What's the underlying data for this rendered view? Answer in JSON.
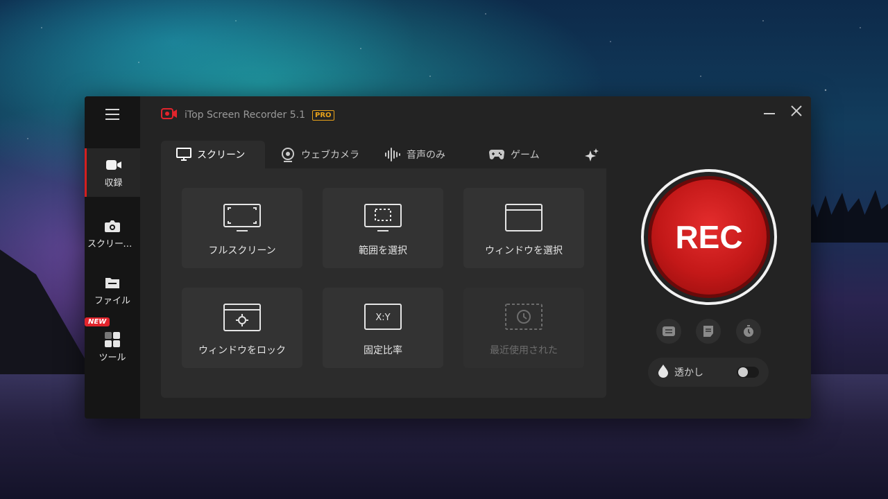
{
  "app": {
    "title": "iTop Screen Recorder 5.1",
    "badge": "PRO"
  },
  "sidebar": {
    "items": [
      {
        "label": "収録",
        "icon": "video-camera-icon"
      },
      {
        "label": "スクリーン…",
        "icon": "camera-icon"
      },
      {
        "label": "ファイル",
        "icon": "folder-icon"
      },
      {
        "label": "ツール",
        "icon": "grid-tools-icon",
        "badge": "NEW"
      }
    ]
  },
  "tabs": [
    {
      "label": "スクリーン",
      "icon": "monitor-icon"
    },
    {
      "label": "ウェブカメラ",
      "icon": "webcam-icon"
    },
    {
      "label": "音声のみ",
      "icon": "audio-wave-icon"
    },
    {
      "label": "ゲーム",
      "icon": "gamepad-icon"
    }
  ],
  "modes": [
    {
      "label": "フルスクリーン",
      "icon": "fullscreen-icon"
    },
    {
      "label": "範囲を選択",
      "icon": "select-region-icon"
    },
    {
      "label": "ウィンドウを選択",
      "icon": "select-window-icon"
    },
    {
      "label": "ウィンドウをロック",
      "icon": "lock-window-icon"
    },
    {
      "label": "固定比率",
      "icon": "fixed-ratio-icon",
      "ratio_text": "X:Y"
    },
    {
      "label": "最近使用された",
      "icon": "recent-icon"
    }
  ],
  "rec": {
    "label": "REC"
  },
  "watermark": {
    "label": "透かし",
    "enabled": false
  },
  "colors": {
    "accent": "#d41f1f",
    "pro": "#e8a21a",
    "window_bg": "#232323"
  }
}
